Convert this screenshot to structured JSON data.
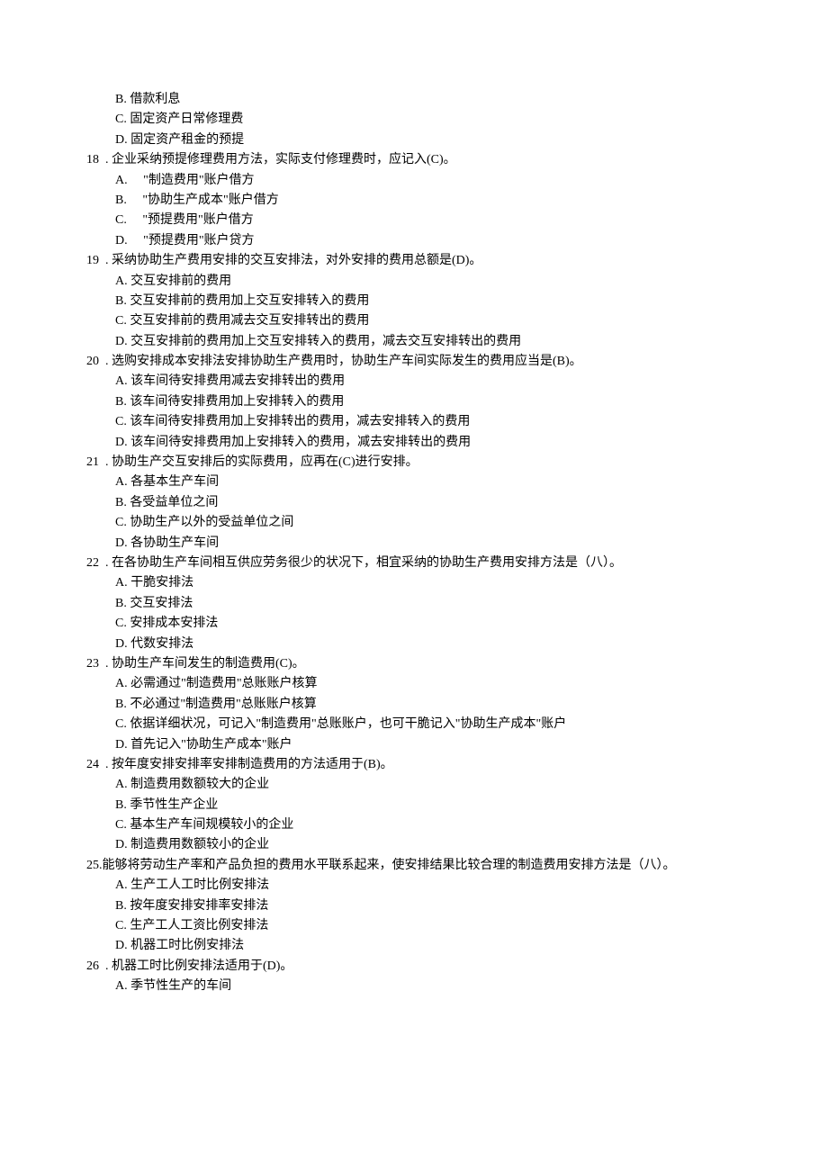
{
  "lines": [
    {
      "cls": "indent-opt",
      "text": "B. 借款利息"
    },
    {
      "cls": "indent-opt",
      "text": "C. 固定资产日常修理费"
    },
    {
      "cls": "indent-opt",
      "text": "D. 固定资产租金的预提"
    },
    {
      "cls": "indent-q",
      "text": "18  . 企业采纳预提修理费用方法，实际支付修理费时，应记入(C)。"
    },
    {
      "cls": "indent-opt",
      "text": "A.     \"制造费用\"账户借方"
    },
    {
      "cls": "indent-opt",
      "text": "B.     \"协助生产成本\"账户借方"
    },
    {
      "cls": "indent-opt",
      "text": "C.     \"预提费用\"账户借方"
    },
    {
      "cls": "indent-opt",
      "text": "D.     \"预提费用\"账户贷方"
    },
    {
      "cls": "indent-q",
      "text": "19  . 采纳协助生产费用安排的交互安排法，对外安排的费用总额是(D)。"
    },
    {
      "cls": "indent-opt",
      "text": "A. 交互安排前的费用"
    },
    {
      "cls": "indent-opt",
      "text": "B. 交互安排前的费用加上交互安排转入的费用"
    },
    {
      "cls": "indent-opt",
      "text": "C. 交互安排前的费用减去交互安排转出的费用"
    },
    {
      "cls": "indent-opt",
      "text": "D. 交互安排前的费用加上交互安排转入的费用，减去交互安排转出的费用"
    },
    {
      "cls": "indent-q",
      "text": "20  . 选购安排成本安排法安排协助生产费用时，协助生产车间实际发生的费用应当是(B)。"
    },
    {
      "cls": "indent-opt",
      "text": "A. 该车间待安排费用减去安排转出的费用"
    },
    {
      "cls": "indent-opt",
      "text": "B. 该车间待安排费用加上安排转入的费用"
    },
    {
      "cls": "indent-opt",
      "text": "C. 该车间待安排费用加上安排转出的费用，减去安排转入的费用"
    },
    {
      "cls": "indent-opt",
      "text": "D. 该车间待安排费用加上安排转入的费用，减去安排转出的费用"
    },
    {
      "cls": "indent-q",
      "text": "21  . 协助生产交互安排后的实际费用，应再在(C)进行安排。"
    },
    {
      "cls": "indent-opt",
      "text": "A. 各基本生产车间"
    },
    {
      "cls": "indent-opt",
      "text": "B. 各受益单位之间"
    },
    {
      "cls": "indent-opt",
      "text": "C. 协助生产以外的受益单位之间"
    },
    {
      "cls": "indent-opt",
      "text": "D. 各协助生产车间"
    },
    {
      "cls": "indent-q",
      "text": "22  . 在各协助生产车间相互供应劳务很少的状况下，相宜采纳的协助生产费用安排方法是（八）。"
    },
    {
      "cls": "indent-opt",
      "text": "A. 干脆安排法"
    },
    {
      "cls": "indent-opt",
      "text": "B. 交互安排法"
    },
    {
      "cls": "indent-opt",
      "text": "C. 安排成本安排法"
    },
    {
      "cls": "indent-opt",
      "text": "D. 代数安排法"
    },
    {
      "cls": "indent-q",
      "text": "23  . 协助生产车间发生的制造费用(C)。"
    },
    {
      "cls": "indent-opt",
      "text": "A. 必需通过\"制造费用\"总账账户核算"
    },
    {
      "cls": "indent-opt",
      "text": "B. 不必通过\"制造费用\"总账账户核算"
    },
    {
      "cls": "indent-opt",
      "text": "C. 依据详细状况，可记入\"制造费用\"总账账户，也可干脆记入\"协助生产成本\"账户"
    },
    {
      "cls": "indent-opt",
      "text": "D. 首先记入\"协助生产成本\"账户"
    },
    {
      "cls": "indent-q",
      "text": "24  . 按年度安排安排率安排制造费用的方法适用于(B)。"
    },
    {
      "cls": "indent-opt",
      "text": "A. 制造费用数额较大的企业"
    },
    {
      "cls": "indent-opt",
      "text": "B. 季节性生产企业"
    },
    {
      "cls": "indent-opt",
      "text": "C. 基本生产车间规模较小的企业"
    },
    {
      "cls": "indent-opt",
      "text": "D. 制造费用数额较小的企业"
    },
    {
      "cls": "indent-q",
      "text": "25.能够将劳动生产率和产品负担的费用水平联系起来，使安排结果比较合理的制造费用安排方法是（八）。"
    },
    {
      "cls": "indent-opt",
      "text": "A. 生产工人工时比例安排法"
    },
    {
      "cls": "indent-opt",
      "text": "B. 按年度安排安排率安排法"
    },
    {
      "cls": "indent-opt",
      "text": "C. 生产工人工资比例安排法"
    },
    {
      "cls": "indent-opt",
      "text": "D. 机器工时比例安排法"
    },
    {
      "cls": "indent-q",
      "text": "26  . 机器工时比例安排法适用于(D)。"
    },
    {
      "cls": "indent-opt",
      "text": "A. 季节性生产的车间"
    }
  ]
}
